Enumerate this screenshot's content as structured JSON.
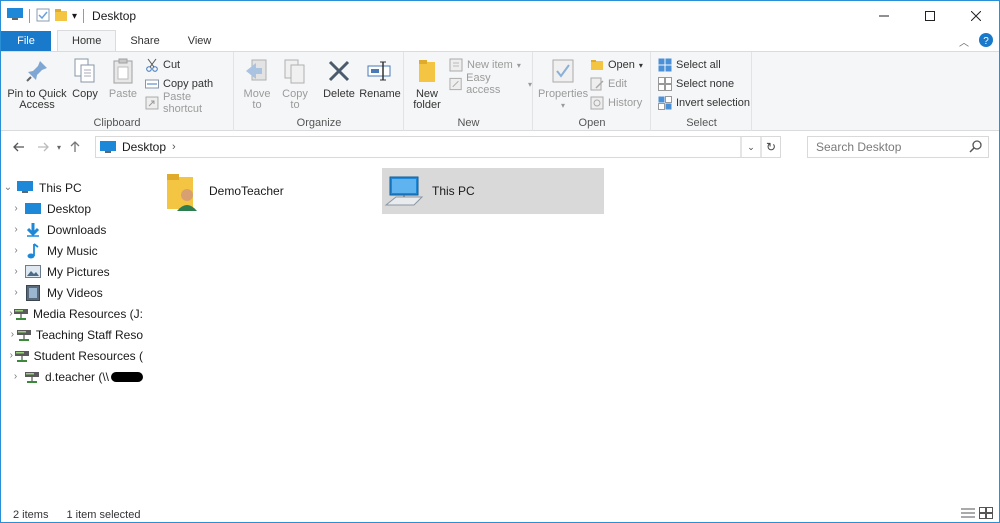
{
  "window": {
    "title": "Desktop"
  },
  "tabs": [
    "File",
    "Home",
    "Share",
    "View"
  ],
  "ribbon": {
    "clipboard": {
      "label": "Clipboard",
      "pin": "Pin to Quick Access",
      "pin_line1": "Pin to Quick",
      "pin_line2": "Access",
      "copy": "Copy",
      "paste": "Paste",
      "cut": "Cut",
      "copy_path": "Copy path",
      "paste_shortcut": "Paste shortcut"
    },
    "organize": {
      "label": "Organize",
      "move_to_1": "Move",
      "move_to_2": "to",
      "copy_to_1": "Copy",
      "copy_to_2": "to",
      "delete": "Delete",
      "rename": "Rename"
    },
    "new": {
      "label": "New",
      "new_folder_1": "New",
      "new_folder_2": "folder",
      "new_item": "New item",
      "easy_access": "Easy access"
    },
    "open": {
      "label": "Open",
      "properties": "Properties",
      "open": "Open",
      "edit": "Edit",
      "history": "History"
    },
    "select": {
      "label": "Select",
      "select_all": "Select all",
      "select_none": "Select none",
      "invert": "Invert selection"
    }
  },
  "address": {
    "path": "Desktop"
  },
  "search": {
    "placeholder": "Search Desktop"
  },
  "navpane": {
    "root": "This PC",
    "items": [
      {
        "label": "Desktop",
        "icon": "desktop-icon"
      },
      {
        "label": "Downloads",
        "icon": "download-icon"
      },
      {
        "label": "My Music",
        "icon": "music-icon"
      },
      {
        "label": "My Pictures",
        "icon": "pictures-icon"
      },
      {
        "label": "My Videos",
        "icon": "videos-icon"
      },
      {
        "label": "Media Resources (J:",
        "icon": "network-drive-icon"
      },
      {
        "label": "Teaching Staff Reso",
        "icon": "network-drive-icon"
      },
      {
        "label": "Student Resources (",
        "icon": "network-drive-icon"
      },
      {
        "label": "d.teacher (\\\\",
        "icon": "network-drive-icon"
      }
    ]
  },
  "files": [
    {
      "name": "DemoTeacher",
      "icon": "user-folder-icon",
      "selected": false
    },
    {
      "name": "This PC",
      "icon": "computer-icon",
      "selected": true
    }
  ],
  "status": {
    "count": "2 items",
    "selection": "1 item selected"
  },
  "colors": {
    "accent": "#1979ca",
    "selection": "#d9d9d9",
    "ribbon_bg": "#f5f6f7"
  }
}
